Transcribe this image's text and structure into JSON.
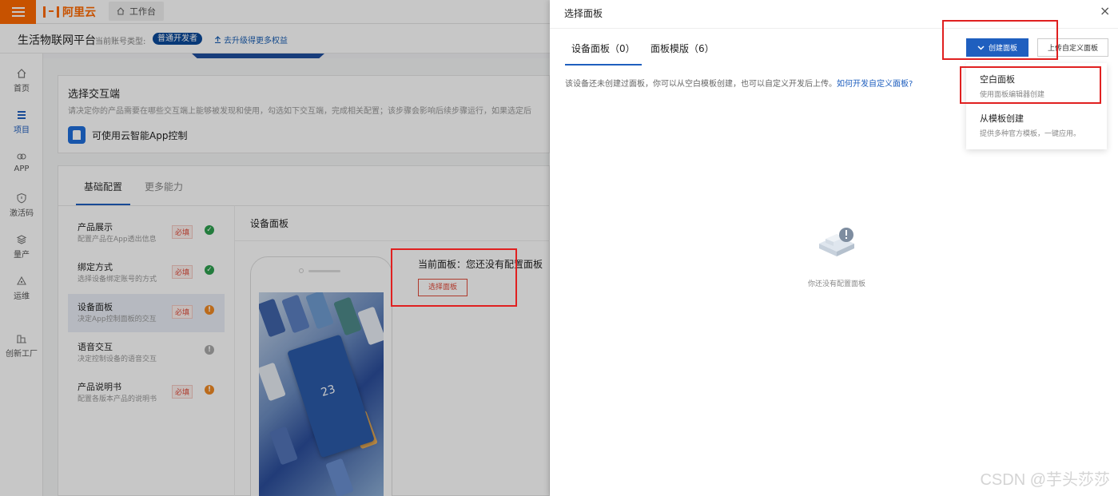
{
  "topbar": {
    "brand": "阿里云",
    "workbench": "工作台"
  },
  "header": {
    "platform": "生活物联网平台",
    "account_label": "当前账号类型:",
    "account_type": "普通开发者",
    "upgrade": "去升级得更多权益"
  },
  "sidebar": {
    "items": [
      {
        "label": "首页",
        "icon": "home-icon"
      },
      {
        "label": "项目",
        "icon": "project-icon"
      },
      {
        "label": "APP",
        "icon": "app-icon"
      },
      {
        "label": "激活码",
        "icon": "shield-icon"
      },
      {
        "label": "量产",
        "icon": "layers-icon"
      },
      {
        "label": "运维",
        "icon": "ops-icon"
      },
      {
        "label": "创新工厂",
        "icon": "factory-icon"
      }
    ]
  },
  "interaction": {
    "title": "选择交互端",
    "desc": "请决定你的产品需要在哪些交互端上能够被发现和使用，勾选如下交互端，完成相关配置；该步骤会影响后续步骤运行，如果选定后",
    "app_control": "可使用云智能App控制"
  },
  "config": {
    "tabs": [
      "基础配置",
      "更多能力"
    ],
    "items": [
      {
        "name": "产品展示",
        "sub": "配置产品在App透出信息",
        "required": "必填",
        "status": "ok"
      },
      {
        "name": "绑定方式",
        "sub": "选择设备绑定账号的方式",
        "required": "必填",
        "status": "ok"
      },
      {
        "name": "设备面板",
        "sub": "决定App控制面板的交互",
        "required": "必填",
        "status": "warn"
      },
      {
        "name": "语音交互",
        "sub": "决定控制设备的语音交互",
        "required": "",
        "status": "gray"
      },
      {
        "name": "产品说明书",
        "sub": "配置各版本产品的说明书",
        "required": "必填",
        "status": "warn"
      }
    ],
    "panel_heading": "设备面板",
    "current_panel": "当前面板：您还没有配置面板",
    "select_button": "选择面板",
    "phone_temp": "23"
  },
  "drawer": {
    "title": "选择面板",
    "close": "×",
    "tabs": [
      "设备面板（0）",
      "面板模版（6）"
    ],
    "create_button": "创建面板",
    "upload_button": "上传自定义面板",
    "hint": "该设备还未创建过面板，你可以从空白模板创建，也可以自定义开发后上传。",
    "hint_link": "如何开发自定义面板?",
    "dropdown": [
      {
        "title": "空白面板",
        "desc": "使用面板编辑器创建"
      },
      {
        "title": "从模板创建",
        "desc": "提供多种官方模板，一键应用。"
      }
    ],
    "empty_text": "你还没有配置面板"
  },
  "watermark": "CSDN @芋头莎莎",
  "colors": {
    "accent": "#1f5fbf",
    "brand": "#ff6a00",
    "highlight": "#e02020"
  }
}
